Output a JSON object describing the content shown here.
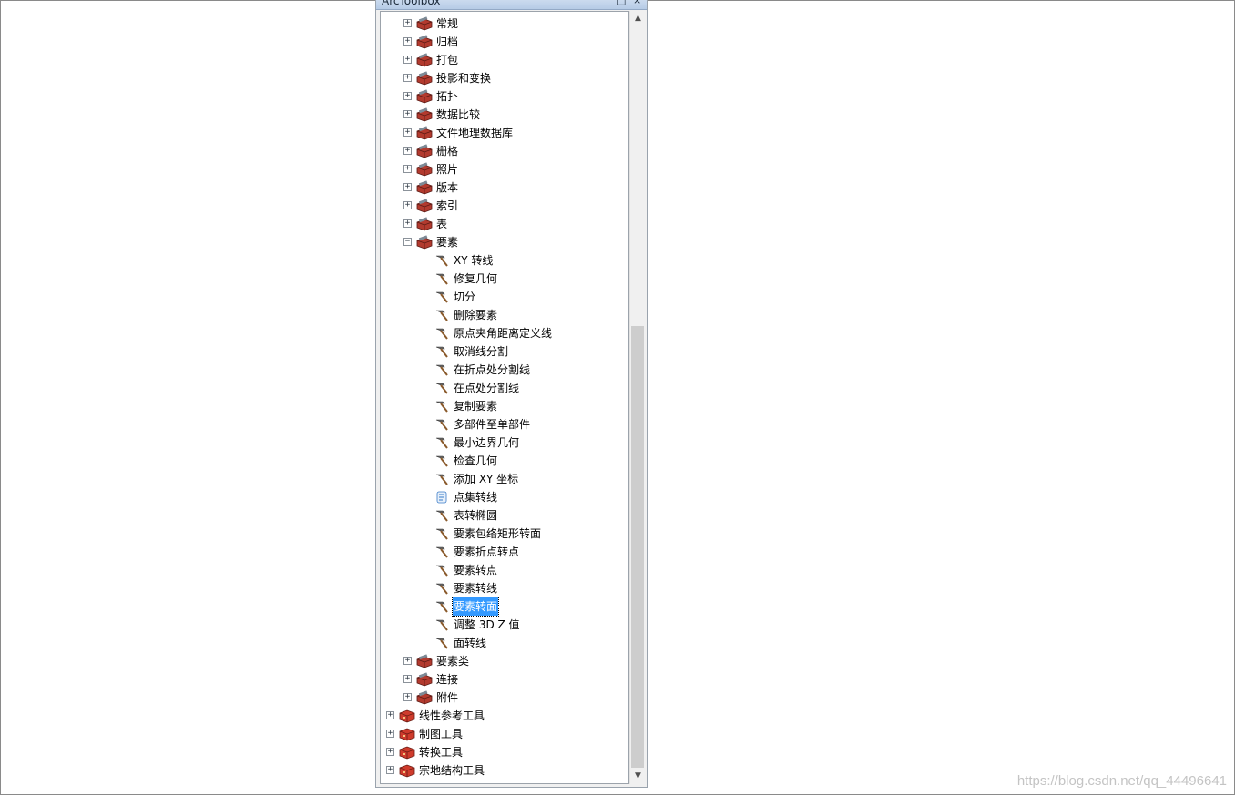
{
  "toolbox": {
    "title": "ArcToolbox",
    "pin_glyph": "□",
    "close_glyph": "×",
    "scroll_up_glyph": "▲",
    "scroll_down_glyph": "▼",
    "expand_glyph": "+",
    "collapse_glyph": "−"
  },
  "tree": [
    {
      "label": "常规",
      "level": 1,
      "icon": "toolset-icon",
      "expander": "plus"
    },
    {
      "label": "归档",
      "level": 1,
      "icon": "toolset-icon",
      "expander": "plus"
    },
    {
      "label": "打包",
      "level": 1,
      "icon": "toolset-icon",
      "expander": "plus"
    },
    {
      "label": "投影和变换",
      "level": 1,
      "icon": "toolset-icon",
      "expander": "plus"
    },
    {
      "label": "拓扑",
      "level": 1,
      "icon": "toolset-icon",
      "expander": "plus"
    },
    {
      "label": "数据比较",
      "level": 1,
      "icon": "toolset-icon",
      "expander": "plus"
    },
    {
      "label": "文件地理数据库",
      "level": 1,
      "icon": "toolset-icon",
      "expander": "plus"
    },
    {
      "label": "栅格",
      "level": 1,
      "icon": "toolset-icon",
      "expander": "plus"
    },
    {
      "label": "照片",
      "level": 1,
      "icon": "toolset-icon",
      "expander": "plus"
    },
    {
      "label": "版本",
      "level": 1,
      "icon": "toolset-icon",
      "expander": "plus"
    },
    {
      "label": "索引",
      "level": 1,
      "icon": "toolset-icon",
      "expander": "plus"
    },
    {
      "label": "表",
      "level": 1,
      "icon": "toolset-icon",
      "expander": "plus"
    },
    {
      "label": "要素",
      "level": 1,
      "icon": "toolset-icon",
      "expander": "minus"
    },
    {
      "label": "XY 转线",
      "level": 2,
      "icon": "hammer-icon",
      "expander": "none"
    },
    {
      "label": "修复几何",
      "level": 2,
      "icon": "hammer-icon",
      "expander": "none"
    },
    {
      "label": "切分",
      "level": 2,
      "icon": "hammer-icon",
      "expander": "none"
    },
    {
      "label": "删除要素",
      "level": 2,
      "icon": "hammer-icon",
      "expander": "none"
    },
    {
      "label": "原点夹角距离定义线",
      "level": 2,
      "icon": "hammer-icon",
      "expander": "none"
    },
    {
      "label": "取消线分割",
      "level": 2,
      "icon": "hammer-icon",
      "expander": "none"
    },
    {
      "label": "在折点处分割线",
      "level": 2,
      "icon": "hammer-icon",
      "expander": "none"
    },
    {
      "label": "在点处分割线",
      "level": 2,
      "icon": "hammer-icon",
      "expander": "none"
    },
    {
      "label": "复制要素",
      "level": 2,
      "icon": "hammer-icon",
      "expander": "none"
    },
    {
      "label": "多部件至单部件",
      "level": 2,
      "icon": "hammer-icon",
      "expander": "none"
    },
    {
      "label": "最小边界几何",
      "level": 2,
      "icon": "hammer-icon",
      "expander": "none"
    },
    {
      "label": "检查几何",
      "level": 2,
      "icon": "hammer-icon",
      "expander": "none"
    },
    {
      "label": "添加 XY 坐标",
      "level": 2,
      "icon": "hammer-icon",
      "expander": "none"
    },
    {
      "label": "点集转线",
      "level": 2,
      "icon": "script-icon",
      "expander": "none"
    },
    {
      "label": "表转椭圆",
      "level": 2,
      "icon": "hammer-icon",
      "expander": "none"
    },
    {
      "label": "要素包络矩形转面",
      "level": 2,
      "icon": "hammer-icon",
      "expander": "none"
    },
    {
      "label": "要素折点转点",
      "level": 2,
      "icon": "hammer-icon",
      "expander": "none"
    },
    {
      "label": "要素转点",
      "level": 2,
      "icon": "hammer-icon",
      "expander": "none"
    },
    {
      "label": "要素转线",
      "level": 2,
      "icon": "hammer-icon",
      "expander": "none"
    },
    {
      "label": "要素转面",
      "level": 2,
      "icon": "hammer-icon",
      "expander": "none",
      "selected": true
    },
    {
      "label": "调整 3D Z 值",
      "level": 2,
      "icon": "hammer-icon",
      "expander": "none"
    },
    {
      "label": "面转线",
      "level": 2,
      "icon": "hammer-icon",
      "expander": "none"
    },
    {
      "label": "要素类",
      "level": 1,
      "icon": "toolset-icon",
      "expander": "plus"
    },
    {
      "label": "连接",
      "level": 1,
      "icon": "toolset-icon",
      "expander": "plus"
    },
    {
      "label": "附件",
      "level": 1,
      "icon": "toolset-icon",
      "expander": "plus"
    },
    {
      "label": "线性参考工具",
      "level": 0,
      "icon": "toolbox-icon",
      "expander": "plus"
    },
    {
      "label": "制图工具",
      "level": 0,
      "icon": "toolbox-icon",
      "expander": "plus"
    },
    {
      "label": "转换工具",
      "level": 0,
      "icon": "toolbox-icon",
      "expander": "plus"
    },
    {
      "label": "宗地结构工具",
      "level": 0,
      "icon": "toolbox-icon",
      "expander": "plus"
    }
  ],
  "watermark": "https://blog.csdn.net/qq_44496641",
  "colors": {
    "map_line": "#0a1f8f",
    "selection": "#3399ff",
    "toolbox_red": "#c0392b"
  }
}
